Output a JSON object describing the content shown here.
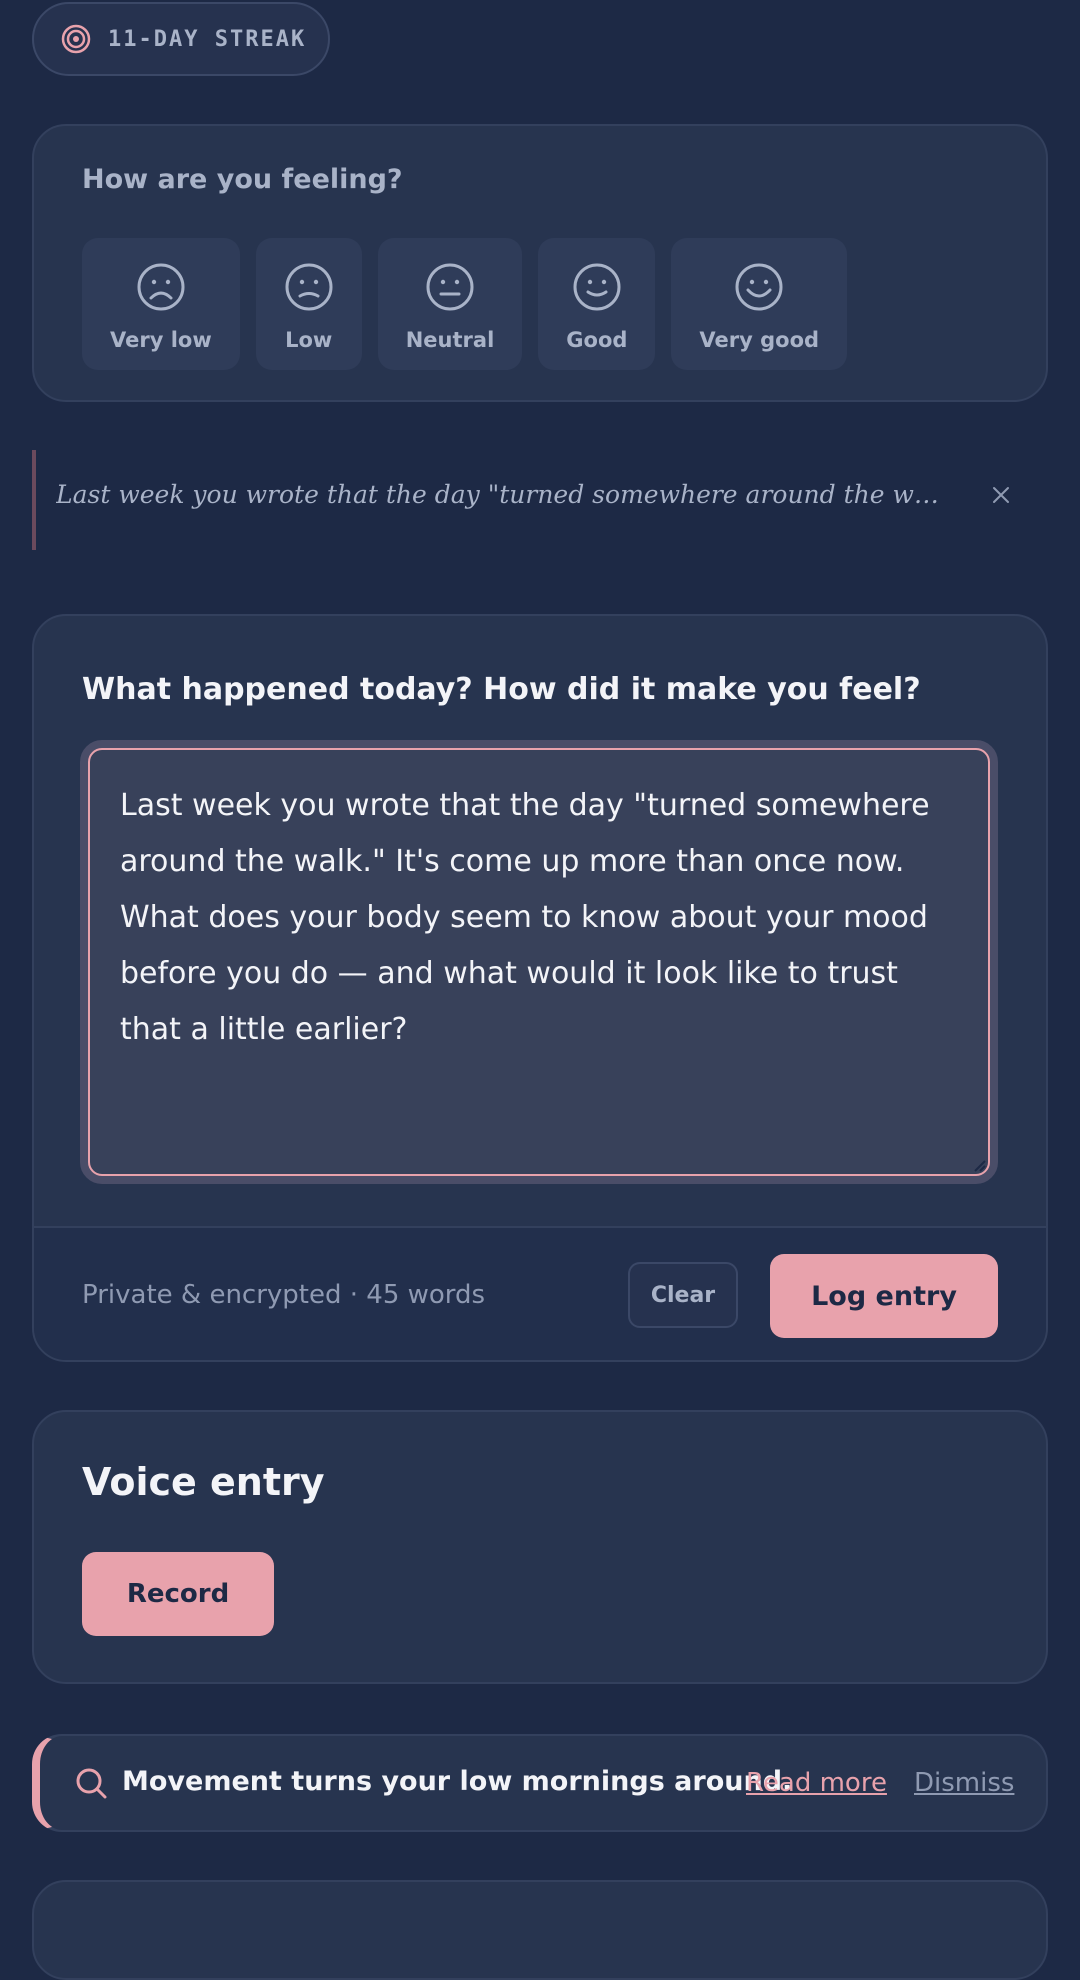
{
  "streak": {
    "label": "11-DAY STREAK",
    "icon": "target-icon"
  },
  "mood": {
    "title": "How are you feeling?",
    "options": [
      {
        "label": "Very low",
        "icon": "very-sad-face-icon"
      },
      {
        "label": "Low",
        "icon": "sad-face-icon"
      },
      {
        "label": "Neutral",
        "icon": "neutral-face-icon"
      },
      {
        "label": "Good",
        "icon": "smile-face-icon"
      },
      {
        "label": "Very good",
        "icon": "big-smile-face-icon"
      }
    ]
  },
  "reminder": {
    "text": "Last week you wrote that the day \"turned somewhere around the walk.\" It's come up more than once now.",
    "close_icon": "close-icon"
  },
  "journal": {
    "question": "What happened today? How did it make you feel?",
    "entry": "Last week you wrote that the day \"turned somewhere around the walk.\" It's come up more than once now. What does your body seem to know about your mood before you do — and what would it look like to trust that a little earlier?",
    "meta": "Private & encrypted · 45 words",
    "clear_label": "Clear",
    "log_label": "Log entry"
  },
  "voice": {
    "title": "Voice entry",
    "record_label": "Record"
  },
  "insight": {
    "icon": "search-icon",
    "text": "Movement turns your low mornings around.",
    "read_more": "Read more",
    "dismiss": "Dismiss"
  },
  "colors": {
    "background": "#1d2945",
    "card": "#27344f",
    "accent": "#e8a2ac",
    "text_primary": "#f3f4f8",
    "text_muted": "#a9b3c8"
  }
}
